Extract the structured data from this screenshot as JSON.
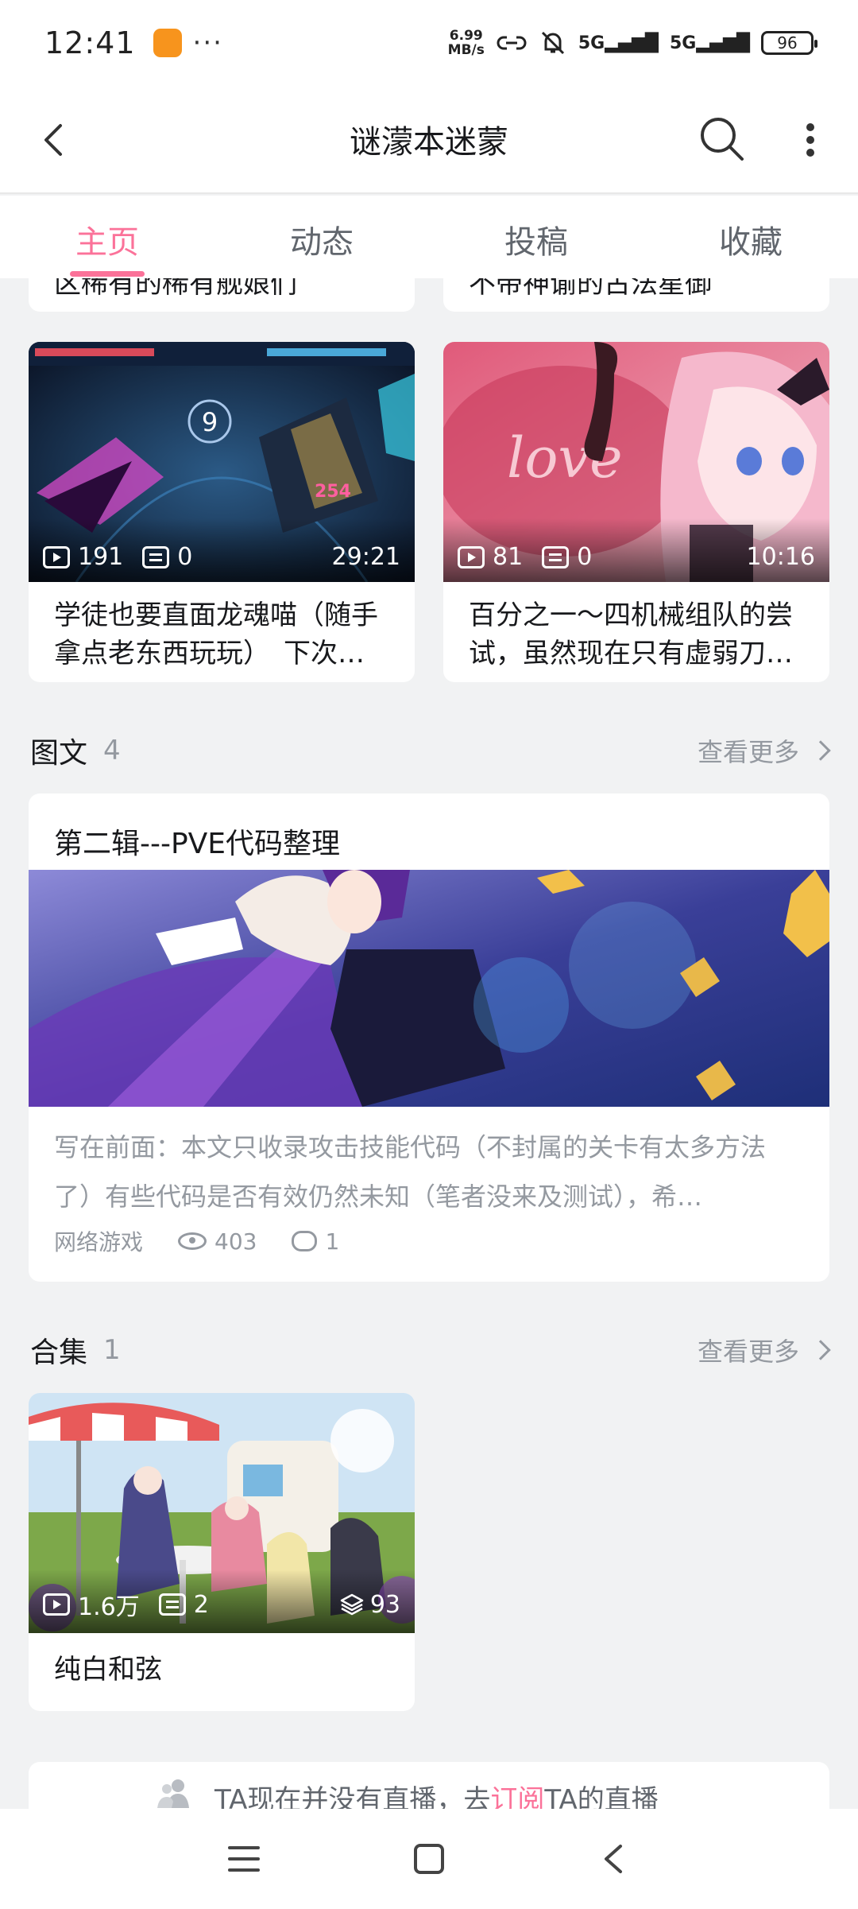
{
  "status_bar": {
    "time": "12:41",
    "dots": "···",
    "net_speed_value": "6.99",
    "net_speed_unit": "MB/s",
    "sig1": "5G",
    "sig2": "5G",
    "battery": "96"
  },
  "nav": {
    "title": "谜濛本迷蒙"
  },
  "tabs": [
    {
      "label": "主页"
    },
    {
      "label": "动态"
    },
    {
      "label": "投稿"
    },
    {
      "label": "收藏"
    }
  ],
  "cut_cards": [
    {
      "title": "区稀有的稀有舰娘们"
    },
    {
      "title": "不带神谕的古法星御"
    }
  ],
  "videos": [
    {
      "views": "191",
      "danmaku": "0",
      "duration": "29:21",
      "title": "学徒也要直面龙魂喵（随手拿点老东西玩玩）　下次…",
      "game_hud_number": "9",
      "game_hud_damage": "254"
    },
    {
      "views": "81",
      "danmaku": "0",
      "duration": "10:16",
      "title": "百分之一～四机械组队的尝试，虽然现在只有虚弱刀…",
      "art_text": "love"
    }
  ],
  "articles_section": {
    "name": "图文",
    "count": "4",
    "more": "查看更多"
  },
  "article": {
    "title": "第二辑---PVE代码整理",
    "excerpt": "写在前面：本文只收录攻击技能代码（不封属的关卡有太多方法了）有些代码是否有效仍然未知（笔者没来及测试），希…",
    "category": "网络游戏",
    "views": "403",
    "comments": "1"
  },
  "collections_section": {
    "name": "合集",
    "count": "1",
    "more": "查看更多"
  },
  "collection": {
    "views": "1.6万",
    "danmaku": "2",
    "episodes": "93",
    "title": "纯白和弦"
  },
  "live": {
    "prefix": "TA现在并没有直播，去",
    "link": "订阅",
    "suffix": "TA的直播"
  },
  "colors": {
    "accent": "#fb7299",
    "bg": "#f1f2f3",
    "text": "#18191c",
    "muted": "#9499a0"
  }
}
